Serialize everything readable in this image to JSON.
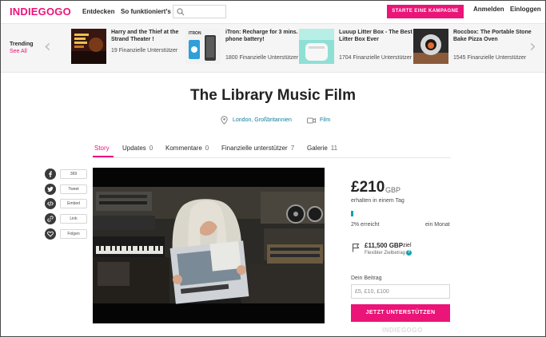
{
  "header": {
    "logo": "INDIEGOGO",
    "nav": [
      "Entdecken",
      "So funktioniert's"
    ],
    "cta": "STARTE EINE KAMPAGNE",
    "login": "Anmelden",
    "signup": "Einloggen"
  },
  "trending": {
    "label": "Trending",
    "see_all": "See All",
    "items": [
      {
        "title": "Harry and the Thief at the Strand Theater !",
        "backers": "19 Finanzielle Unterstützer"
      },
      {
        "title": "iTron: Recharge for 3 mins. for 1 phone battery!",
        "backers": "1800 Finanzielle Unterstützer",
        "thumb_text": "ITRON"
      },
      {
        "title": "Luuup Litter Box - The Best Cat Litter Box Ever",
        "backers": "1704 Finanzielle Unterstützer"
      },
      {
        "title": "Roccbox: The Portable Stone Bake Pizza Oven",
        "backers": "1545 Finanzielle Unterstützer"
      }
    ]
  },
  "project": {
    "title": "The Library Music Film",
    "location": "London, Großbritannien",
    "category": "Film"
  },
  "tabs": [
    {
      "label": "Story",
      "count": ""
    },
    {
      "label": "Updates",
      "count": "0"
    },
    {
      "label": "Kommentare",
      "count": "0"
    },
    {
      "label": "Finanzielle unterstützer",
      "count": "7"
    },
    {
      "label": "Galerie",
      "count": "11"
    }
  ],
  "share": [
    {
      "icon": "facebook-icon",
      "label": "369"
    },
    {
      "icon": "twitter-icon",
      "label": "Tweet"
    },
    {
      "icon": "embed-icon",
      "label": "Embed"
    },
    {
      "icon": "link-icon",
      "label": "Link"
    },
    {
      "icon": "heart-icon",
      "label": "Folgen"
    }
  ],
  "funding": {
    "amount": "£210",
    "currency": "GBP",
    "received": "erhalten in einem Tag",
    "percent_text": "2% erreicht",
    "percent_value": 2,
    "remaining": "ein Monat",
    "goal": "£11,500 GBP",
    "goal_suffix": "ziel",
    "flexible": "Flexibler Zielbetrag",
    "contribution_label": "Dein Beitrag",
    "contribution_placeholder": "£5, £10, £100",
    "back_button": "JETZT UNTERSTÜTZEN",
    "watermark": "INDIEGOGO"
  },
  "colors": {
    "brand": "#eb1478",
    "teal": "#13a0ad",
    "link": "#0f7d9c"
  }
}
